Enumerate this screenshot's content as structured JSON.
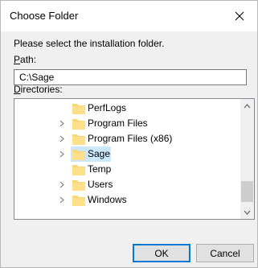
{
  "window": {
    "title": "Choose Folder",
    "close_icon": "close-icon"
  },
  "instruction": "Please select the installation folder.",
  "path": {
    "label_mnemonic": "P",
    "label_rest": "ath:",
    "value": "C:\\Sage"
  },
  "directories": {
    "label_mnemonic": "D",
    "label_rest": "irectories:",
    "items": [
      {
        "name": "PerfLogs",
        "expandable": false,
        "selected": false
      },
      {
        "name": "Program Files",
        "expandable": true,
        "selected": false
      },
      {
        "name": "Program Files (x86)",
        "expandable": true,
        "selected": false
      },
      {
        "name": "Sage",
        "expandable": true,
        "selected": true
      },
      {
        "name": "Temp",
        "expandable": false,
        "selected": false
      },
      {
        "name": "Users",
        "expandable": true,
        "selected": false
      },
      {
        "name": "Windows",
        "expandable": true,
        "selected": false
      }
    ]
  },
  "buttons": {
    "ok": "OK",
    "cancel": "Cancel"
  },
  "colors": {
    "selection": "#cce8ff",
    "folder": "#f8d775",
    "accent": "#0078d7"
  }
}
